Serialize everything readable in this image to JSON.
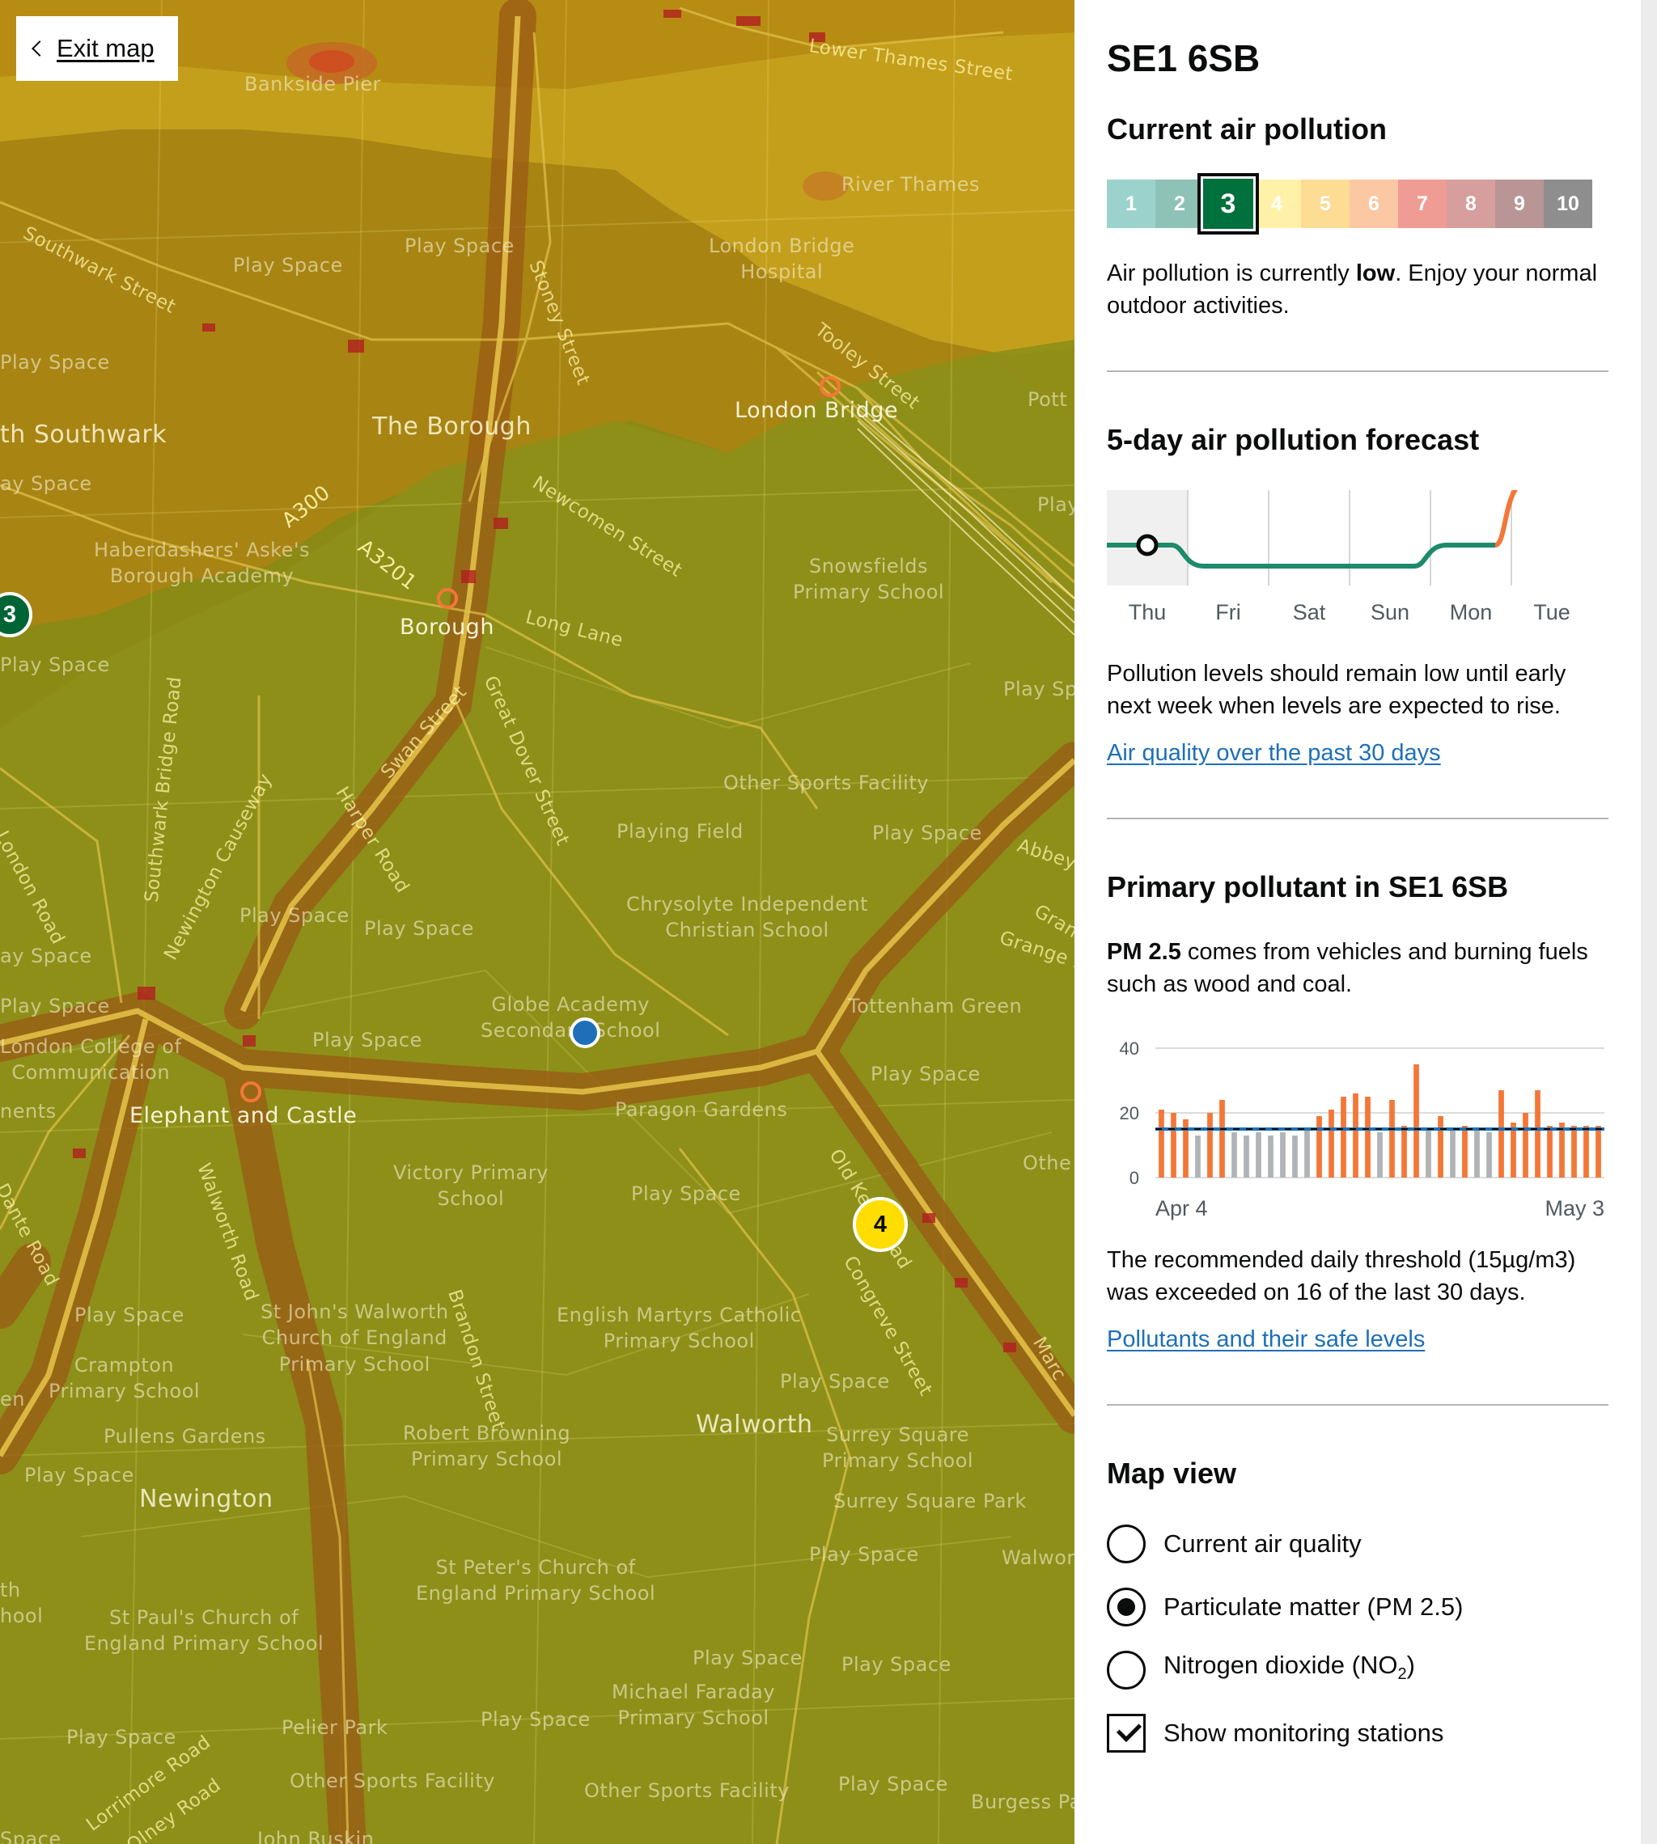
{
  "map": {
    "exit_button": "Exit map",
    "markers": [
      {
        "label": "3",
        "color": "#006435"
      },
      {
        "label": "4",
        "color": "#ffdd00"
      }
    ],
    "labels": {
      "bankside_pier": "Bankside Pier",
      "lower_thames_street": "Lower Thames Street",
      "river_thames": "River Thames",
      "london_bridge_hospital": "London Bridge\nHospital",
      "southwark_street": "Southwark Street",
      "play_space_1": "Play Space",
      "play_space_2": "Play Space",
      "play_space_3": "Play Space",
      "stoney_street": "Stoney Street",
      "tooley_street": "Tooley Street",
      "london_bridge": "London Bridge",
      "potts": "Pott",
      "south_southwark": "th Southwark",
      "play_space_4": "ay Space",
      "the_borough": "The Borough",
      "a300": "A300",
      "a3201": "A3201",
      "newcomen_street": "Newcomen Street",
      "haberdashers": "Haberdashers' Aske's\nBorough Academy",
      "snowsfields": "Snowsfields\nPrimary School",
      "play_right_1": "Play",
      "borough": "Borough",
      "long_lane": "Long Lane",
      "play_space_5": "Play Space",
      "play_sp_right": "Play Sp",
      "swan_street": "Swan Street",
      "great_dover_street": "Great Dover Street",
      "southwark_bridge_road": "Southwark Bridge Road",
      "newington_causeway": "Newington Causeway",
      "harper_road": "Harper Road",
      "london_road": "London Road",
      "other_sports_facility_1": "Other Sports Facility",
      "playing_field": "Playing Field",
      "play_space_6": "Play Space",
      "abbey": "Abbey",
      "play_space_7": "Play Space",
      "play_space_8": "Play Space",
      "chrysolyte": "Chrysolyte Independent\nChristian School",
      "gran": "Gran",
      "grange": "Grange R",
      "play_space_9": "ay Space",
      "play_space_10": "Play Space",
      "globe_academy": "Globe Academy\nSecondary School",
      "tottenham_green": "Tottenham Green",
      "london_college": "London College of\nCommunication",
      "play_space_11": "Play Space",
      "play_space_12": "Play Space",
      "ments": "nents",
      "elephant_castle": "Elephant and Castle",
      "paragon_gardens": "Paragon Gardens",
      "dante_road": "Dante Road",
      "walworth_road": "Walworth Road",
      "victory_primary": "Victory Primary\nSchool",
      "play_space_13": "Play Space",
      "other_right": "Othe",
      "old_kent_road": "Old Kent Road",
      "congreve_street": "Congreve Street",
      "play_space_14": "Play Space",
      "st_johns": "St John's Walworth\nChurch of England\nPrimary School",
      "brandon_street": "Brandon Street",
      "english_martyrs": "English Martyrs Catholic\nPrimary School",
      "marc": "Marc",
      "crampton": "Crampton\nPrimary School",
      "play_space_15": "Play Space",
      "en": "en",
      "pullens_gardens": "Pullens Gardens",
      "robert_browning": "Robert Browning\nPrimary School",
      "walworth": "Walworth",
      "surrey_square_primary": "Surrey Square\nPrimary School",
      "play_space_16": "Play Space",
      "newington": "Newington",
      "surrey_square_park": "Surrey Square Park",
      "play_space_17": "Play Space",
      "walwor": "Walwor",
      "st_peters": "St Peter's Church of\nEngland Primary School",
      "th_school": "th\nhool",
      "st_pauls": "St Paul's Church of\nEngland Primary School",
      "play_space_18": "Play Space",
      "play_space_19": "Play Space",
      "michael_faraday": "Michael Faraday\nPrimary School",
      "play_space_20": "Play Space",
      "pelier_park": "Pelier Park",
      "play_space_21": "Play Space",
      "lorrimore_road": "Lorrimore Road",
      "other_sports_facility_2": "Other Sports Facility",
      "other_sports_facility_3": "Other Sports Facility",
      "play_space_22": "Play Space",
      "burgess_park": "Burgess Pa",
      "olney_road": "Olney Road",
      "john_ruskin": "John Ruskin",
      "space_bottom": "Space"
    }
  },
  "panel": {
    "postcode": "SE1 6SB",
    "current": {
      "heading": "Current air pollution",
      "scale": [
        {
          "label": "1",
          "color": "#9bd3cc"
        },
        {
          "label": "2",
          "color": "#8fc2b6"
        },
        {
          "label": "3",
          "color": "#00703c",
          "selected": true
        },
        {
          "label": "4",
          "color": "#fff2a8"
        },
        {
          "label": "5",
          "color": "#fddc94"
        },
        {
          "label": "6",
          "color": "#fbc8a3"
        },
        {
          "label": "7",
          "color": "#ef9c94"
        },
        {
          "label": "8",
          "color": "#d69e9c"
        },
        {
          "label": "9",
          "color": "#b99595"
        },
        {
          "label": "10",
          "color": "#8e8e8e"
        }
      ],
      "desc_before": "Air pollution is currently ",
      "desc_bold": "low",
      "desc_after": ". Enjoy your normal outdoor activities."
    },
    "forecast": {
      "heading": "5-day air pollution forecast",
      "days": [
        "Thu",
        "Fri",
        "Sat",
        "Sun",
        "Mon",
        "Tue"
      ],
      "levels": [
        3,
        2,
        2,
        2,
        3,
        6
      ],
      "line_color": "#1d8a6b",
      "rise_color": "#f47738",
      "desc": "Pollution levels should remain low until early next week when levels are expected to rise.",
      "link": "Air quality over the past 30 days"
    },
    "primary": {
      "heading": "Primary pollutant in SE1 6SB",
      "desc_bold": "PM 2.5",
      "desc": " comes from vehicles and burning fuels such as wood and coal.",
      "threshold_desc": "The recommended daily threshold (15µg/m3) was exceeded on 16 of the last 30 days.",
      "link": "Pollutants and their safe levels"
    },
    "map_view": {
      "heading": "Map view",
      "options": [
        {
          "label": "Current air quality",
          "checked": false
        },
        {
          "label": "Particulate matter (PM 2.5)",
          "checked": true
        },
        {
          "label_prefix": "Nitrogen dioxide (NO",
          "label_sub": "2",
          "label_suffix": ")",
          "checked": false
        }
      ],
      "checkbox": {
        "label": "Show monitoring stations",
        "checked": true
      }
    }
  },
  "chart_data": {
    "type": "bar",
    "title": "",
    "xlabel": "",
    "ylabel": "",
    "ylim": [
      0,
      40
    ],
    "yticks": [
      0,
      20,
      40
    ],
    "x_tick_labels": [
      "Apr 4",
      "May 3"
    ],
    "threshold": 15,
    "threshold_label": "15µg/m3",
    "average": 15,
    "colors": {
      "above": "#f47738",
      "below": "#b1b4b6",
      "threshold": "#1d70b8",
      "average": "#0b0c0c"
    },
    "values": [
      21,
      20,
      18,
      13,
      20,
      24,
      14,
      13,
      14,
      13,
      14,
      13,
      15,
      19,
      21,
      25,
      26,
      25,
      14,
      24,
      16,
      35,
      15,
      19,
      15,
      16,
      15,
      14,
      27,
      17,
      20,
      27,
      16,
      17,
      16,
      16,
      16
    ]
  }
}
